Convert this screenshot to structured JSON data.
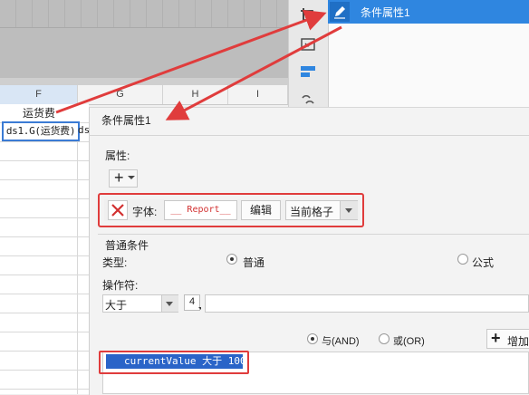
{
  "spreadsheet": {
    "columns": [
      "F",
      "G",
      "H",
      "I"
    ],
    "cell_f1": "运货费",
    "cell_f2": "ds1.G(运货费)",
    "cell_g2": "ds"
  },
  "condition_list": {
    "selected_label": "条件属性1"
  },
  "dialog": {
    "title": "条件属性1",
    "attributes_label": "属性:",
    "add_symbol": "+",
    "attribute_row": {
      "font_label": "字体:",
      "font_preview": "__ Report__",
      "edit_label": "编辑",
      "scope_value": "当前格子"
    },
    "normal_condition_label": "普通条件",
    "type_label": "类型:",
    "type_normal": "普通",
    "type_formula": "公式",
    "operator_label": "操作符:",
    "operator_value": "大于",
    "value_type_icon": "4",
    "logic_and": "与(AND)",
    "logic_or": "或(OR)",
    "add_condition_symbol": "+",
    "add_condition_label": "增加",
    "condition_item": "currentValue 大于 100"
  },
  "colors": {
    "highlight_red": "#e03c3c",
    "selection_blue": "#2f86e0",
    "condition_blue": "#2a64c8"
  }
}
